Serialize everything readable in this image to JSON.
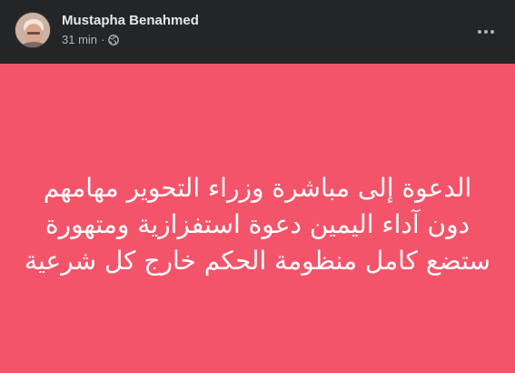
{
  "post": {
    "author_name": "Mustapha Benahmed",
    "timestamp": "31 min",
    "separator": "·",
    "privacy_icon": "globe-icon",
    "more_icon": "more-horizontal-icon",
    "avatar": "author-avatar",
    "background_color": "#f3546a",
    "text": "الدعوة إلى مباشرة وزراء التحوير مهامهم دون آداء اليمين دعوة استفزازية ومتهورة ستضع كامل منظومة الحكم خارج كل شرعية"
  },
  "colors": {
    "header_background": "#242526",
    "name_text": "#e4e6eb",
    "meta_text": "#b0b3b8",
    "post_text": "#ffffff"
  }
}
